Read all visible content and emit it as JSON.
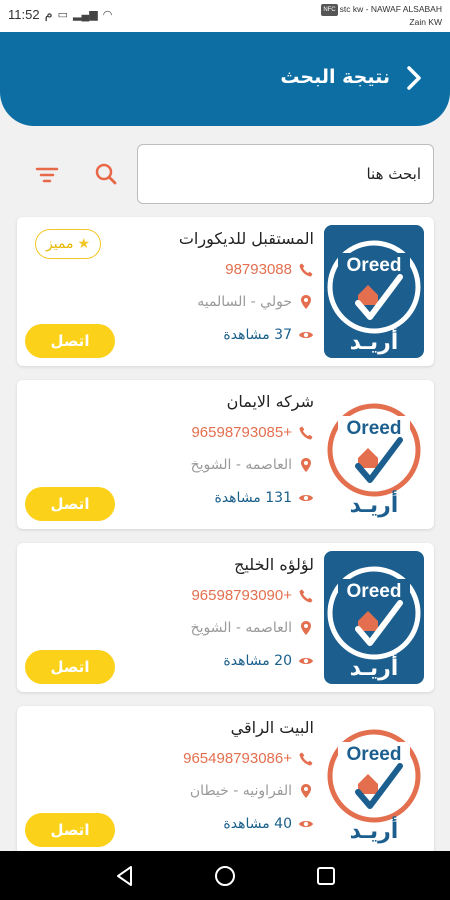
{
  "status_bar": {
    "time": "11:52",
    "time_suffix": "م",
    "carrier_line1": "stc kw - NAWAF ALSABAH",
    "carrier_line2": "Zain KW",
    "nfc_badge": "NFC"
  },
  "header": {
    "title": "نتيجة البحث",
    "back_icon": "chevron-right-icon",
    "bg_color": "#0d6ea4"
  },
  "search": {
    "placeholder": "ابحث هنا",
    "value": ""
  },
  "toolbar": {
    "search_icon": "search-icon",
    "filter_icon": "filter-icon",
    "icon_color": "#e8694a"
  },
  "results": [
    {
      "name": "المستقبل للديكورات",
      "phone": "98793088",
      "location": "حولي - السالميه",
      "views": "37 مشاهدة",
      "call_label": "اتصل",
      "featured": true,
      "featured_label": "مميز",
      "logo_style": "blue",
      "logo_text": "Oreed",
      "logo_arabic": "أريـد"
    },
    {
      "name": "شركه الايمان",
      "phone": "+96598793085",
      "location": "العاصمه - الشويخ",
      "views": "131 مشاهدة",
      "call_label": "اتصل",
      "featured": false,
      "logo_style": "white",
      "logo_text": "Oreed",
      "logo_arabic": "أريـد"
    },
    {
      "name": "لؤلؤه الخليج",
      "phone": "+96598793090",
      "location": "العاصمه - الشويخ",
      "views": "20 مشاهدة",
      "call_label": "اتصل",
      "featured": false,
      "logo_style": "blue",
      "logo_text": "Oreed",
      "logo_arabic": "أريـد"
    },
    {
      "name": "البيت الراقي",
      "phone": "+965498793086",
      "location": "الفراونيه - خيطان",
      "views": "40 مشاهدة",
      "call_label": "اتصل",
      "featured": false,
      "logo_style": "white",
      "logo_text": "Oreed",
      "logo_arabic": "أريـد"
    }
  ],
  "nav_bar": {
    "back_icon": "nav-back-icon",
    "home_icon": "nav-home-icon",
    "recent_icon": "nav-recent-apps-icon"
  }
}
